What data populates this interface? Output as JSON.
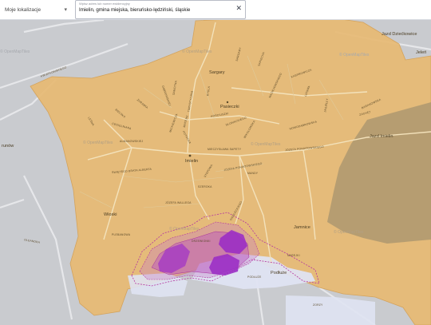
{
  "top_bar": {
    "location_select_label": "Moje lokalizacje",
    "search_caption": "Wpisz adres lub numer ewidencyjny",
    "search_value": "Imielin, gmina miejska, bieruńsko-lędziński, śląskie"
  },
  "map_labels": {
    "places": [
      "Sargary",
      "Pasieczki",
      "Imielin",
      "Wioski",
      "Jamnice",
      "Podłuże",
      "Jazd Dziećkowice",
      "Jazd Imielin",
      "Jeleń",
      "runów"
    ],
    "streets": [
      "SAPIECHA",
      "SARGARY",
      "KASPROWICZA",
      "LEŚNA",
      "BIELSKA",
      "ŻURAWIA",
      "TURYSTYCZNA",
      "DĄBROWSKIEJ",
      "MACIEJOWSKIEGO",
      "SAMOTNA",
      "RYDLA",
      "LIPOWA",
      "CEGIELNIANA",
      "MICKIEWICZA",
      "MATEJKI",
      "KOŚCIUSZKI",
      "SŁOWACKIEGO",
      "BARANOWSKA",
      "JAGIEŁŁY",
      "ZACHĘT",
      "NOWODĄBROWSKA",
      "MIKOŁOWSKA",
      "POTOCKA",
      "MIECZYSŁAWA SAPETY",
      "JÓZEFA PONIATOWSKIEGO",
      "ŚWIĘTEGO BRATA ALBERTA",
      "STEPOWA",
      "JÓZEFA PONIATOWSKIEGO",
      "MANDY",
      "JÓZEFA WALLEGA",
      "PLEBANOWA",
      "SIEDLECKIEGO",
      "OLEANDRA",
      "DRZEWIONKI",
      "NAREJKI",
      "PODŁUŻE",
      "ZORZY",
      "ALMANOWSKIEJ",
      "SZEROKA",
      "KWIATKOWSKIEGO"
    ],
    "watermarks": [
      "© OpenMapTiles",
      "© OpenMapTiles",
      "© OpenMapTiles",
      "© OpenMapTiles",
      "© OpenMapTiles",
      "© OpenMapTiles",
      "© OpenMapTiles"
    ]
  },
  "colors": {
    "municipality_fill": "#e7ba73",
    "background": "#c9cbcf",
    "forest": "#b09a70",
    "water": "#dfe3f2",
    "heatmap": "#a43ac4",
    "heatmap_border": "#b436a0",
    "road": "#d9c9a6"
  }
}
